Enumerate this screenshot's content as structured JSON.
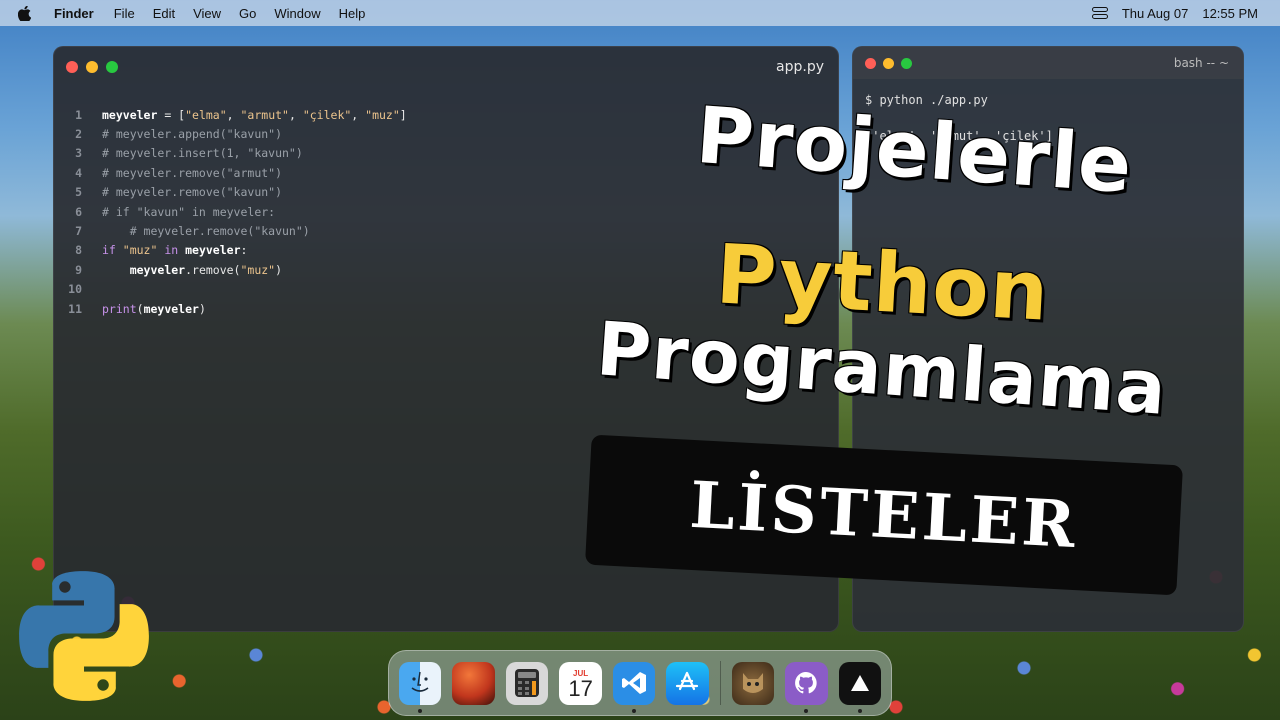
{
  "menubar": {
    "app_name": "Finder",
    "menus": [
      "File",
      "Edit",
      "View",
      "Go",
      "Window",
      "Help"
    ],
    "date": "Thu Aug 07",
    "time": "12:55 PM"
  },
  "editor": {
    "title": "app.py",
    "lines": [
      {
        "n": "1",
        "tokens": [
          [
            "var",
            "meyveler"
          ],
          [
            "plain",
            " = ["
          ],
          [
            "str",
            "\"elma\""
          ],
          [
            "plain",
            ", "
          ],
          [
            "str",
            "\"armut\""
          ],
          [
            "plain",
            ", "
          ],
          [
            "str",
            "\"çilek\""
          ],
          [
            "plain",
            ", "
          ],
          [
            "str",
            "\"muz\""
          ],
          [
            "plain",
            "]"
          ]
        ]
      },
      {
        "n": "2",
        "tokens": [
          [
            "cm",
            "# meyveler.append(\"kavun\")"
          ]
        ]
      },
      {
        "n": "3",
        "tokens": [
          [
            "cm",
            "# meyveler.insert(1, \"kavun\")"
          ]
        ]
      },
      {
        "n": "4",
        "tokens": [
          [
            "cm",
            "# meyveler.remove(\"armut\")"
          ]
        ]
      },
      {
        "n": "5",
        "tokens": [
          [
            "cm",
            "# meyveler.remove(\"kavun\")"
          ]
        ]
      },
      {
        "n": "6",
        "tokens": [
          [
            "cm",
            "# if \"kavun\" in meyveler:"
          ]
        ]
      },
      {
        "n": "7",
        "tokens": [
          [
            "cm",
            "    # meyveler.remove(\"kavun\")"
          ]
        ]
      },
      {
        "n": "8",
        "tokens": [
          [
            "kw",
            "if "
          ],
          [
            "str",
            "\"muz\""
          ],
          [
            "kw",
            " in "
          ],
          [
            "var",
            "meyveler"
          ],
          [
            "plain",
            ":"
          ]
        ]
      },
      {
        "n": "9",
        "tokens": [
          [
            "plain",
            "    "
          ],
          [
            "var",
            "meyveler"
          ],
          [
            "plain",
            ".remove("
          ],
          [
            "str",
            "\"muz\""
          ],
          [
            "plain",
            ")"
          ]
        ]
      },
      {
        "n": "10",
        "tokens": []
      },
      {
        "n": "11",
        "tokens": [
          [
            "fn",
            "print"
          ],
          [
            "plain",
            "("
          ],
          [
            "var",
            "meyveler"
          ],
          [
            "plain",
            ")"
          ]
        ]
      }
    ]
  },
  "terminal": {
    "title": "bash -- ~",
    "command": "$ python ./app.py",
    "output": "['elma', 'armut', 'çilek']"
  },
  "overlay": {
    "line1": "Projelerle",
    "line2": "Python",
    "line3": "Programlama",
    "banner": "LİSTELER"
  },
  "dock": {
    "calendar_month": "JUL",
    "calendar_day": "17"
  },
  "colors": {
    "python_yellow": "#f7cc3a",
    "python_blue": "#3776ab"
  }
}
